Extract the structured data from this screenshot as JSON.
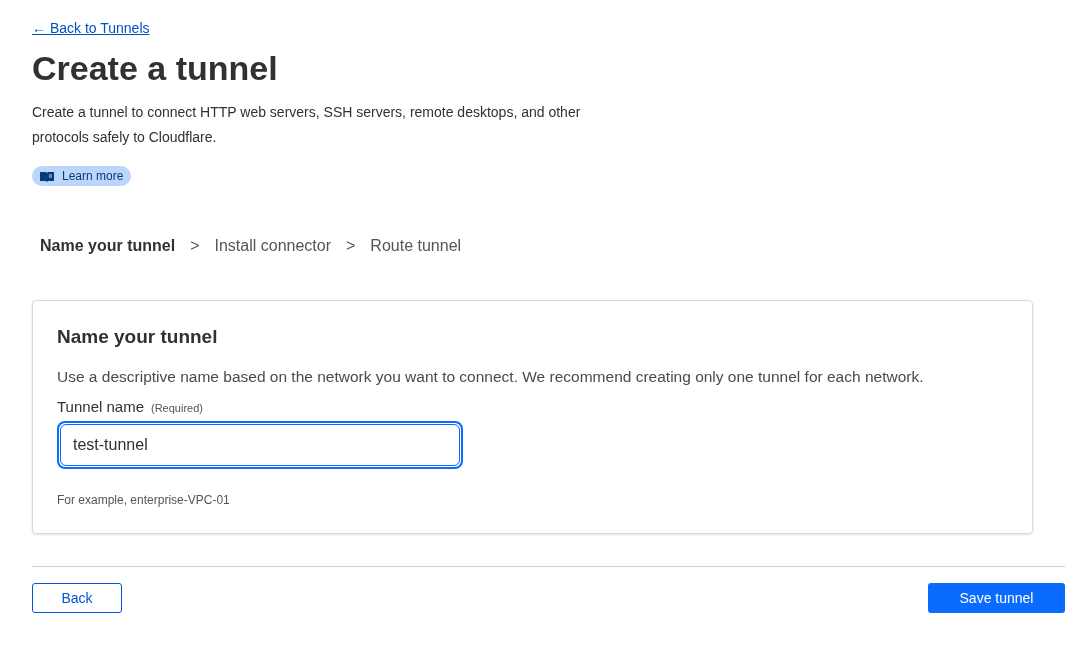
{
  "back_link": "← Back to Tunnels",
  "title": "Create a tunnel",
  "description": "Create a tunnel to connect HTTP web servers, SSH servers, remote desktops, and other protocols safely to Cloudflare.",
  "learn_more": "Learn more",
  "steps": [
    {
      "label": "Name your tunnel",
      "selected": true
    },
    {
      "label": "Install connector",
      "selected": false
    },
    {
      "label": "Route tunnel",
      "selected": false
    }
  ],
  "step_separator": ">",
  "card": {
    "title": "Name your tunnel",
    "text": "Use a descriptive name based on the network you want to connect. We recommend creating only one tunnel for each network.",
    "field": {
      "label": "Tunnel name",
      "required": "(Required)",
      "value": "test-tunnel",
      "focused": true,
      "hint": "For example, enterprise-VPC-01"
    }
  },
  "buttons": {
    "back": "Back",
    "save": "Save tunnel"
  }
}
